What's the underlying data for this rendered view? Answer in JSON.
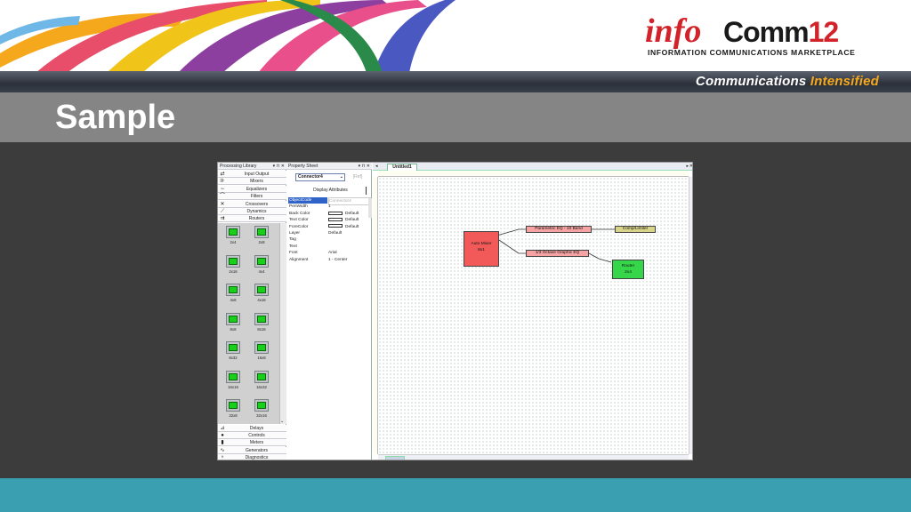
{
  "header": {
    "logo_info": "info",
    "logo_comm": "Comm",
    "logo_year": "12",
    "logo_sub": "INFORMATION COMMUNICATIONS MARKETPLACE",
    "tagline_a": "Communications",
    "tagline_b": "Intensified"
  },
  "slide": {
    "title": "Sample"
  },
  "library": {
    "title": "Processing Library",
    "controls": "▾ ⊓ ✕",
    "categories_top": [
      {
        "label": "Input Output",
        "icon": "⇄"
      },
      {
        "label": "Mixers",
        "icon": "⊪"
      },
      {
        "label": "Equalizers",
        "icon": "∼"
      },
      {
        "label": "Filters",
        "icon": "⌒"
      },
      {
        "label": "Crossovers",
        "icon": "✕"
      },
      {
        "label": "Dynamics",
        "icon": "⟋"
      },
      {
        "label": "Routers",
        "icon": "⇉"
      }
    ],
    "tiles": [
      "2x4",
      "2x8",
      "2x16",
      "4x4",
      "4x8",
      "4x16",
      "8x8",
      "8x16",
      "8x32",
      "16x8",
      "16x16",
      "16x32",
      "32x8",
      "32x16"
    ],
    "categories_bottom": [
      {
        "label": "Delays",
        "icon": "⊿"
      },
      {
        "label": "Controls",
        "icon": "●"
      },
      {
        "label": "Meters",
        "icon": "▮"
      },
      {
        "label": "Generators",
        "icon": "∿"
      },
      {
        "label": "Diagnostics",
        "icon": "♆"
      }
    ]
  },
  "property_sheet": {
    "title": "Property Sheet",
    "controls": "▾ ⊓ ✕",
    "selected": "Connector4",
    "button": "[Ref]",
    "display": "Display Attributes",
    "rows": [
      {
        "name": "ObjectCode",
        "value": "Connector4"
      },
      {
        "name": "PenWidth",
        "value": "1"
      },
      {
        "name": "Back Color",
        "value": "Default"
      },
      {
        "name": "Text Color",
        "value": "Default"
      },
      {
        "name": "ForeColor",
        "value": "Default"
      },
      {
        "name": "Layer",
        "value": "Default"
      },
      {
        "name": "Tag",
        "value": ""
      },
      {
        "name": "Text",
        "value": ""
      },
      {
        "name": "Font",
        "value": "Arial"
      },
      {
        "name": "Alignment",
        "value": "1 - Center"
      }
    ]
  },
  "canvas": {
    "tab": "Untitled1",
    "blocks": {
      "automixer": "Auto Mixer",
      "automixer_size": "8x1",
      "peq": "Parametric EQ - 10 Band",
      "geq": "1/3 Octave Graphic EQ",
      "comp": "Comp/Limiter",
      "router": "Router",
      "router_size": "2x4"
    }
  },
  "colors": {
    "accent_red": "#d2232a",
    "tagline_orange": "#f6a81c",
    "footer_teal": "#3a9fb0",
    "block_red": "#f25a5a",
    "block_green": "#35d64a",
    "block_olive": "#d8d48a"
  }
}
